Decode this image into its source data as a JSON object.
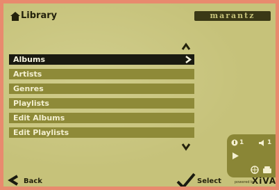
{
  "header": {
    "title": "Library",
    "brand": "marantz"
  },
  "menu": {
    "items": [
      {
        "label": "Albums",
        "selected": true
      },
      {
        "label": "Artists",
        "selected": false
      },
      {
        "label": "Genres",
        "selected": false
      },
      {
        "label": "Playlists",
        "selected": false
      },
      {
        "label": "Edit Albums",
        "selected": false
      },
      {
        "label": "Edit Playlists",
        "selected": false
      }
    ]
  },
  "status": {
    "zone": "1",
    "volume": "1"
  },
  "footer": {
    "back_label": "Back",
    "select_label": "Select",
    "powered_by": "powered by",
    "logo": "XiVA"
  },
  "colors": {
    "screen_bg": "#c6c27a",
    "menu_item": "#8e8a38",
    "menu_selected": "#1a1a10",
    "frame": "#e88a6e"
  }
}
